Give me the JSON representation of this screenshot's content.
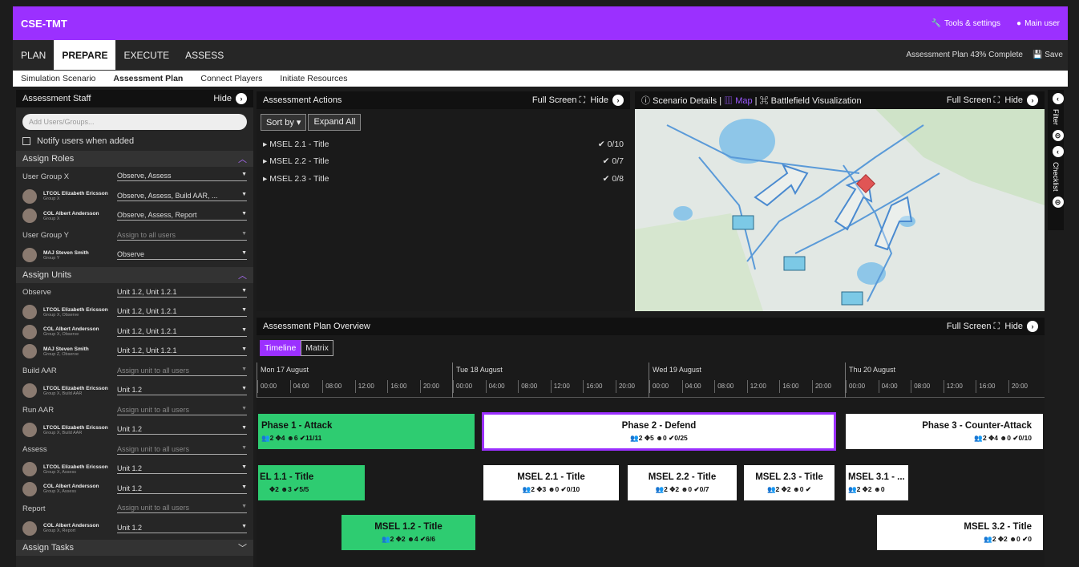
{
  "app": {
    "title": "CSE-TMT",
    "tools": "Tools & settings",
    "user": "Main user"
  },
  "nav": {
    "tabs": [
      "PLAN",
      "PREPARE",
      "EXECUTE",
      "ASSESS"
    ],
    "progress": "Assessment Plan 43% Complete",
    "save": "Save"
  },
  "subnav": [
    "Simulation Scenario",
    "Assessment Plan",
    "Connect Players",
    "Initiate Resources"
  ],
  "staff": {
    "title": "Assessment Staff",
    "hide": "Hide",
    "search_placeholder": "Add Users/Groups...",
    "notify": "Notify users when added"
  },
  "roles": {
    "title": "Assign Roles",
    "group_x": "User Group X",
    "group_x_val": "Observe, Assess",
    "u1_name": "LTCOL Elizabeth Ericsson",
    "u1_group": "Group X",
    "u1_val": "Observe, Assess, Build AAR, ...",
    "u2_name": "COL Albert Andersson",
    "u2_group": "Group X",
    "u2_val": "Observe, Assess, Report",
    "group_y": "User Group Y",
    "group_y_val": "Assign to all users",
    "u3_name": "MAJ Steven Smith",
    "u3_group": "Group Y",
    "u3_val": "Observe"
  },
  "units": {
    "title": "Assign Units",
    "observe": "Observe",
    "observe_val": "Unit 1.2, Unit 1.2.1",
    "o1_name": "LTCOL Elizabeth Ericsson",
    "o1_group": "Group X, Observe",
    "o1_val": "Unit 1.2, Unit 1.2.1",
    "o2_name": "COL Albert Andersson",
    "o2_group": "Group X, Observe",
    "o2_val": "Unit 1.2, Unit 1.2.1",
    "o3_name": "MAJ Steven Smith",
    "o3_group": "Group Z, Observe",
    "o3_val": "Unit 1.2, Unit 1.2.1",
    "build": "Build AAR",
    "build_val": "Assign unit to all users",
    "b1_name": "LTCOL Elizabeth Ericsson",
    "b1_group": "Group X, Build AAR",
    "b1_val": "Unit 1.2",
    "run": "Run AAR",
    "run_val": "Assign unit to all users",
    "r1_name": "LTCOL Elizabeth Ericsson",
    "r1_group": "Group X, Build AAR",
    "r1_val": "Unit 1.2",
    "assess": "Assess",
    "assess_val": "Assign unit to all users",
    "a1_name": "LTCOL Elizabeth Ericsson",
    "a1_group": "Group X, Assess",
    "a1_val": "Unit 1.2",
    "a2_name": "COL Albert Andersson",
    "a2_group": "Group X, Assess",
    "a2_val": "Unit 1.2",
    "report": "Report",
    "report_val": "Assign unit to all users",
    "p1_name": "COL Albert Andersson",
    "p1_group": "Group X, Report",
    "p1_val": "Unit 1.2"
  },
  "tasks": {
    "title": "Assign Tasks"
  },
  "actions": {
    "title": "Assessment Actions",
    "fullscreen": "Full Screen",
    "hide": "Hide",
    "sort": "Sort by",
    "expand": "Expand All",
    "items": [
      {
        "label": "MSEL 2.1 - Title",
        "count": "0/10"
      },
      {
        "label": "MSEL 2.2 - Title",
        "count": "0/7"
      },
      {
        "label": "MSEL 2.3 - Title",
        "count": "0/8"
      }
    ]
  },
  "map": {
    "details": "Scenario Details",
    "map": "Map",
    "viz": "Battlefield Visualization",
    "fullscreen": "Full Screen",
    "hide": "Hide"
  },
  "rail": {
    "filter": "Filter",
    "checklist": "Checklist"
  },
  "overview": {
    "title": "Assessment Plan Overview",
    "fullscreen": "Full Screen",
    "hide": "Hide",
    "timeline": "Timeline",
    "matrix": "Matrix",
    "days": [
      "Mon 17 August",
      "Tue 18 August",
      "Wed 19 August",
      "Thu 20 August"
    ],
    "hours": [
      "00:00",
      "04:00",
      "08:00",
      "12:00",
      "16:00",
      "20:00"
    ]
  },
  "cards": {
    "p1": {
      "title": "Phase 1 - Attack",
      "stat": "👥2 ✥4 ☻6 ✔11/11"
    },
    "p2": {
      "title": "Phase 2 - Defend",
      "stat": "👥2 ✥5 ☻0 ✔0/25"
    },
    "p3": {
      "title": "Phase 3 - Counter-Attack",
      "stat": "👥2 ✥4 ☻0 ✔0/10"
    },
    "m11": {
      "title": "EL 1.1 - Title",
      "stat": "✥2 ☻3 ✔5/5"
    },
    "m21": {
      "title": "MSEL 2.1 - Title",
      "stat": "👥2 ✥3 ☻0 ✔0/10"
    },
    "m22": {
      "title": "MSEL 2.2 - Title",
      "stat": "👥2 ✥2 ☻0 ✔0/7"
    },
    "m23": {
      "title": "MSEL 2.3 - Title",
      "stat": "👥2 ✥2 ☻0 ✔"
    },
    "m31": {
      "title": "MSEL 3.1 - ...",
      "stat": "👥2 ✥2 ☻0"
    },
    "m12": {
      "title": "MSEL 1.2 - Title",
      "stat": "👥2 ✥2 ☻4 ✔6/6"
    },
    "m32": {
      "title": "MSEL 3.2 - Title",
      "stat": "👥2 ✥2 ☻0 ✔0"
    }
  }
}
